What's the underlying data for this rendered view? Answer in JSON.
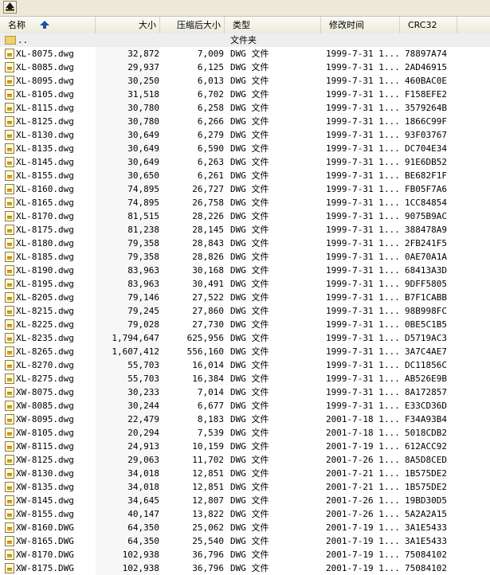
{
  "columns": {
    "name": "名称",
    "size": "大小",
    "packed": "压缩后大小",
    "type": "类型",
    "modified": "修改时间",
    "crc": "CRC32"
  },
  "parent_row": {
    "name": "..",
    "type": "文件夹"
  },
  "files": [
    {
      "name": "XL-8075.dwg",
      "size": "32,872",
      "packed": "7,009",
      "type": "DWG 文件",
      "modified": "1999-7-31 1...",
      "crc": "78897A74"
    },
    {
      "name": "XL-8085.dwg",
      "size": "29,937",
      "packed": "6,125",
      "type": "DWG 文件",
      "modified": "1999-7-31 1...",
      "crc": "2AD46915"
    },
    {
      "name": "XL-8095.dwg",
      "size": "30,250",
      "packed": "6,013",
      "type": "DWG 文件",
      "modified": "1999-7-31 1...",
      "crc": "460BAC0E"
    },
    {
      "name": "XL-8105.dwg",
      "size": "31,518",
      "packed": "6,702",
      "type": "DWG 文件",
      "modified": "1999-7-31 1...",
      "crc": "F158EFE2"
    },
    {
      "name": "XL-8115.dwg",
      "size": "30,780",
      "packed": "6,258",
      "type": "DWG 文件",
      "modified": "1999-7-31 1...",
      "crc": "3579264B"
    },
    {
      "name": "XL-8125.dwg",
      "size": "30,780",
      "packed": "6,266",
      "type": "DWG 文件",
      "modified": "1999-7-31 1...",
      "crc": "1866C99F"
    },
    {
      "name": "XL-8130.dwg",
      "size": "30,649",
      "packed": "6,279",
      "type": "DWG 文件",
      "modified": "1999-7-31 1...",
      "crc": "93F03767"
    },
    {
      "name": "XL-8135.dwg",
      "size": "30,649",
      "packed": "6,590",
      "type": "DWG 文件",
      "modified": "1999-7-31 1...",
      "crc": "DC704E34"
    },
    {
      "name": "XL-8145.dwg",
      "size": "30,649",
      "packed": "6,263",
      "type": "DWG 文件",
      "modified": "1999-7-31 1...",
      "crc": "91E6DB52"
    },
    {
      "name": "XL-8155.dwg",
      "size": "30,650",
      "packed": "6,261",
      "type": "DWG 文件",
      "modified": "1999-7-31 1...",
      "crc": "BE682F1F"
    },
    {
      "name": "XL-8160.dwg",
      "size": "74,895",
      "packed": "26,727",
      "type": "DWG 文件",
      "modified": "1999-7-31 1...",
      "crc": "FB05F7A6"
    },
    {
      "name": "XL-8165.dwg",
      "size": "74,895",
      "packed": "26,758",
      "type": "DWG 文件",
      "modified": "1999-7-31 1...",
      "crc": "1CC84854"
    },
    {
      "name": "XL-8170.dwg",
      "size": "81,515",
      "packed": "28,226",
      "type": "DWG 文件",
      "modified": "1999-7-31 1...",
      "crc": "9075B9AC"
    },
    {
      "name": "XL-8175.dwg",
      "size": "81,238",
      "packed": "28,145",
      "type": "DWG 文件",
      "modified": "1999-7-31 1...",
      "crc": "388478A9"
    },
    {
      "name": "XL-8180.dwg",
      "size": "79,358",
      "packed": "28,843",
      "type": "DWG 文件",
      "modified": "1999-7-31 1...",
      "crc": "2FB241F5"
    },
    {
      "name": "XL-8185.dwg",
      "size": "79,358",
      "packed": "28,826",
      "type": "DWG 文件",
      "modified": "1999-7-31 1...",
      "crc": "0AE70A1A"
    },
    {
      "name": "XL-8190.dwg",
      "size": "83,963",
      "packed": "30,168",
      "type": "DWG 文件",
      "modified": "1999-7-31 1...",
      "crc": "68413A3D"
    },
    {
      "name": "XL-8195.dwg",
      "size": "83,963",
      "packed": "30,491",
      "type": "DWG 文件",
      "modified": "1999-7-31 1...",
      "crc": "9DFF5805"
    },
    {
      "name": "XL-8205.dwg",
      "size": "79,146",
      "packed": "27,522",
      "type": "DWG 文件",
      "modified": "1999-7-31 1...",
      "crc": "B7F1CABB"
    },
    {
      "name": "XL-8215.dwg",
      "size": "79,245",
      "packed": "27,860",
      "type": "DWG 文件",
      "modified": "1999-7-31 1...",
      "crc": "98B998FC"
    },
    {
      "name": "XL-8225.dwg",
      "size": "79,028",
      "packed": "27,730",
      "type": "DWG 文件",
      "modified": "1999-7-31 1...",
      "crc": "0BE5C1B5"
    },
    {
      "name": "XL-8235.dwg",
      "size": "1,794,647",
      "packed": "625,956",
      "type": "DWG 文件",
      "modified": "1999-7-31 1...",
      "crc": "D5719AC3"
    },
    {
      "name": "XL-8265.dwg",
      "size": "1,607,412",
      "packed": "556,160",
      "type": "DWG 文件",
      "modified": "1999-7-31 1...",
      "crc": "3A7C4AE7"
    },
    {
      "name": "XL-8270.dwg",
      "size": "55,703",
      "packed": "16,014",
      "type": "DWG 文件",
      "modified": "1999-7-31 1...",
      "crc": "DC11856C"
    },
    {
      "name": "XL-8275.dwg",
      "size": "55,703",
      "packed": "16,384",
      "type": "DWG 文件",
      "modified": "1999-7-31 1...",
      "crc": "AB526E9B"
    },
    {
      "name": "XW-8075.dwg",
      "size": "30,233",
      "packed": "7,014",
      "type": "DWG 文件",
      "modified": "1999-7-31 1...",
      "crc": "8A172857"
    },
    {
      "name": "XW-8085.dwg",
      "size": "30,244",
      "packed": "6,677",
      "type": "DWG 文件",
      "modified": "1999-7-31 1...",
      "crc": "E33CD36D"
    },
    {
      "name": "XW-8095.dwg",
      "size": "22,479",
      "packed": "8,183",
      "type": "DWG 文件",
      "modified": "2001-7-18 1...",
      "crc": "F34A93B4"
    },
    {
      "name": "XW-8105.dwg",
      "size": "20,294",
      "packed": "7,539",
      "type": "DWG 文件",
      "modified": "2001-7-18 1...",
      "crc": "5018CDB2"
    },
    {
      "name": "XW-8115.dwg",
      "size": "24,913",
      "packed": "10,159",
      "type": "DWG 文件",
      "modified": "2001-7-19 1...",
      "crc": "612ACC92"
    },
    {
      "name": "XW-8125.dwg",
      "size": "29,063",
      "packed": "11,702",
      "type": "DWG 文件",
      "modified": "2001-7-26 1...",
      "crc": "8A5D8CED"
    },
    {
      "name": "XW-8130.dwg",
      "size": "34,018",
      "packed": "12,851",
      "type": "DWG 文件",
      "modified": "2001-7-21 1...",
      "crc": "1B575DE2"
    },
    {
      "name": "XW-8135.dwg",
      "size": "34,018",
      "packed": "12,851",
      "type": "DWG 文件",
      "modified": "2001-7-21 1...",
      "crc": "1B575DE2"
    },
    {
      "name": "XW-8145.dwg",
      "size": "34,645",
      "packed": "12,807",
      "type": "DWG 文件",
      "modified": "2001-7-26 1...",
      "crc": "19BD30D5"
    },
    {
      "name": "XW-8155.dwg",
      "size": "40,147",
      "packed": "13,822",
      "type": "DWG 文件",
      "modified": "2001-7-26 1...",
      "crc": "5A2A2A15"
    },
    {
      "name": "XW-8160.DWG",
      "size": "64,350",
      "packed": "25,062",
      "type": "DWG 文件",
      "modified": "2001-7-19 1...",
      "crc": "3A1E5433"
    },
    {
      "name": "XW-8165.DWG",
      "size": "64,350",
      "packed": "25,540",
      "type": "DWG 文件",
      "modified": "2001-7-19 1...",
      "crc": "3A1E5433"
    },
    {
      "name": "XW-8170.DWG",
      "size": "102,938",
      "packed": "36,796",
      "type": "DWG 文件",
      "modified": "2001-7-19 1...",
      "crc": "75084102"
    },
    {
      "name": "XW-8175.DWG",
      "size": "102,938",
      "packed": "36,796",
      "type": "DWG 文件",
      "modified": "2001-7-19 1...",
      "crc": "75084102"
    }
  ]
}
